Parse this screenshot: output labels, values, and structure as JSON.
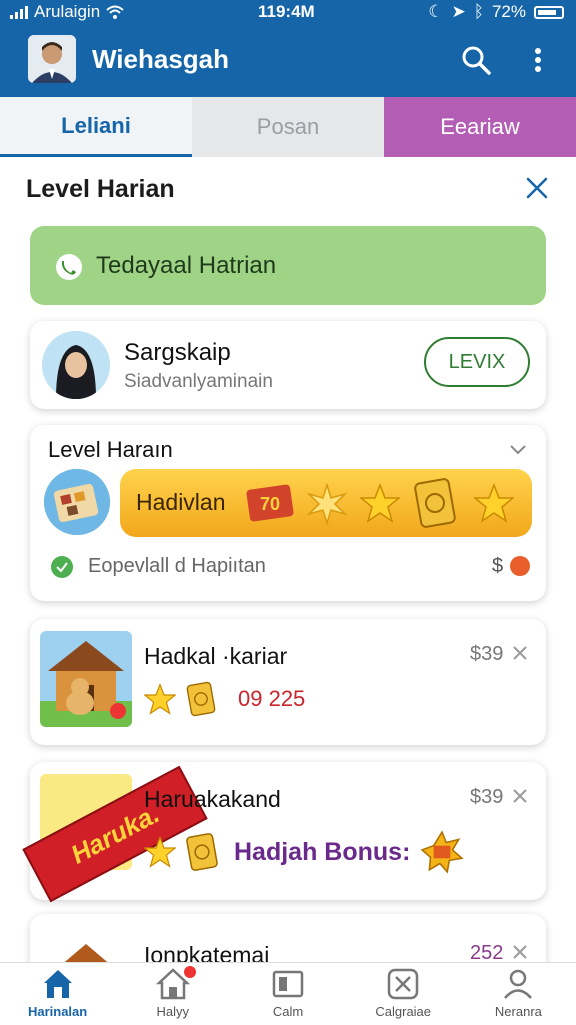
{
  "status_bar": {
    "carrier": "Arulaigin",
    "time": "119:4M",
    "battery": "72%"
  },
  "app_bar": {
    "title": "Wiehasgah"
  },
  "tabs": [
    {
      "label": "Leliani",
      "active": true
    },
    {
      "label": "Posan",
      "active": false
    },
    {
      "label": "Eeariaw",
      "active": false
    }
  ],
  "sheet": {
    "title": "Level Harian",
    "banner": {
      "text": "Tedayaal Hatrian"
    },
    "profile": {
      "name": "Sargskaip",
      "subtitle": "Siadvanlyaminain",
      "button_label": "LEVIX"
    },
    "level_card": {
      "heading": "Level Haraın",
      "bar_label": "Hadivlan",
      "bar_badge": "70",
      "footer_text": "Eopevlall d Hapiıtan",
      "footer_price": "$"
    },
    "games": [
      {
        "title": "Hadkal ·kariar",
        "price": "$39",
        "amount": "09 225"
      },
      {
        "title": "Haruakakand",
        "price": "$39",
        "bonus": "Hadjah Bonus:",
        "ribbon": "Haruka."
      },
      {
        "title": "Ionpkatemai",
        "price": "252"
      }
    ]
  },
  "bottom_nav": [
    {
      "label": "Harinalan",
      "icon": "home-icon",
      "active": true
    },
    {
      "label": "Halyy",
      "icon": "house-icon",
      "active": false,
      "badge": true
    },
    {
      "label": "Calm",
      "icon": "gallery-icon",
      "active": false
    },
    {
      "label": "Calgraiae",
      "icon": "close-box-icon",
      "active": false
    },
    {
      "label": "Neranra",
      "icon": "profile-icon",
      "active": false
    }
  ],
  "colors": {
    "primary": "#1565a8",
    "banner": "#9fd486",
    "tab_accent": "#b45db4",
    "gold": "#f2a71b",
    "ribbon": "#d01f26"
  }
}
